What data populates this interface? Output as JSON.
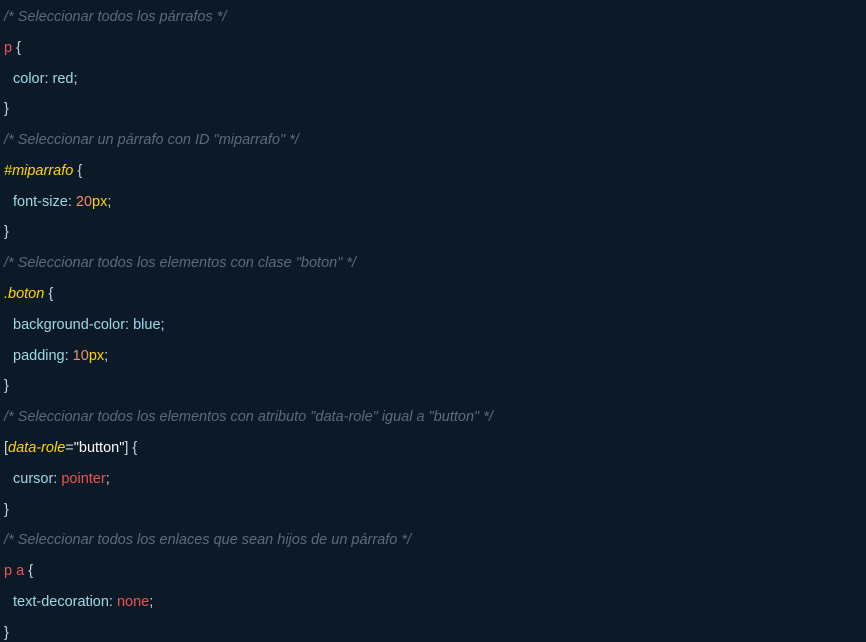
{
  "code": {
    "c1": "/* Seleccionar todos los párrafos */",
    "sel1": "p",
    "brace_open": " {",
    "brace_close": "}",
    "r1_prop": "color",
    "colon": ": ",
    "r1_val": "red",
    "semi": ";",
    "c2": "/* Seleccionar un párrafo con ID \"miparrafo\" */",
    "sel2": "#miparrafo",
    "r2_prop": "font-size",
    "r2_num": "20",
    "r2_unit": "px",
    "c3": "/* Seleccionar todos los elementos con clase \"boton\" */",
    "sel3": ".boton",
    "r3a_prop": "background-color",
    "r3a_val": "blue",
    "r3b_prop": "padding",
    "r3b_num": "10",
    "r3b_unit": "px",
    "c4": "/* Seleccionar todos los elementos con atributo \"data-role\" igual a \"button\" */",
    "sel4_open": "[",
    "sel4_attr": "data-role",
    "sel4_eq": "=",
    "sel4_str": "\"button\"",
    "sel4_close": "]",
    "r4_prop": "cursor",
    "r4_val": "pointer",
    "c5": "/* Seleccionar todos los enlaces que sean hijos de un párrafo */",
    "sel5": "p a",
    "r5_prop": "text-decoration",
    "r5_val": "none"
  },
  "colors": {
    "background": "#0c1a27",
    "comment": "#5a6b7b",
    "tag": "#ef5350",
    "selector_italic": "#ffd600",
    "property": "#9fd8e6",
    "number": "#f78c6c"
  }
}
